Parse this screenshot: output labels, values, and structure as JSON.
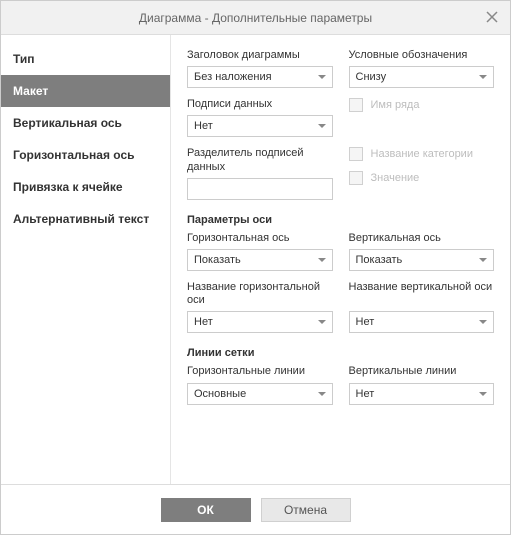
{
  "title": "Диаграмма - Дополнительные параметры",
  "sidebar": {
    "items": [
      {
        "label": "Тип",
        "active": false
      },
      {
        "label": "Макет",
        "active": true
      },
      {
        "label": "Вертикальная ось",
        "active": false
      },
      {
        "label": "Горизонтальная ось",
        "active": false
      },
      {
        "label": "Привязка к ячейке",
        "active": false
      },
      {
        "label": "Альтернативный текст",
        "active": false
      }
    ]
  },
  "labels": {
    "chart_title": "Заголовок диаграммы",
    "legend": "Условные обозначения",
    "data_labels": "Подписи данных",
    "separator": "Разделитель подписей данных",
    "series_name": "Имя ряда",
    "category_name": "Название категории",
    "value": "Значение",
    "axis_params": "Параметры оси",
    "h_axis": "Горизонтальная ось",
    "v_axis": "Вертикальная ось",
    "h_axis_title": "Название горизонтальной оси",
    "v_axis_title": "Название вертикальной оси",
    "gridlines": "Линии сетки",
    "h_lines": "Горизонтальные линии",
    "v_lines": "Вертикальные линии"
  },
  "values": {
    "chart_title": "Без наложения",
    "legend": "Снизу",
    "data_labels": "Нет",
    "separator": "",
    "h_axis": "Показать",
    "v_axis": "Показать",
    "h_axis_title": "Нет",
    "v_axis_title": "Нет",
    "h_lines": "Основные",
    "v_lines": "Нет"
  },
  "buttons": {
    "ok": "ОК",
    "cancel": "Отмена"
  }
}
